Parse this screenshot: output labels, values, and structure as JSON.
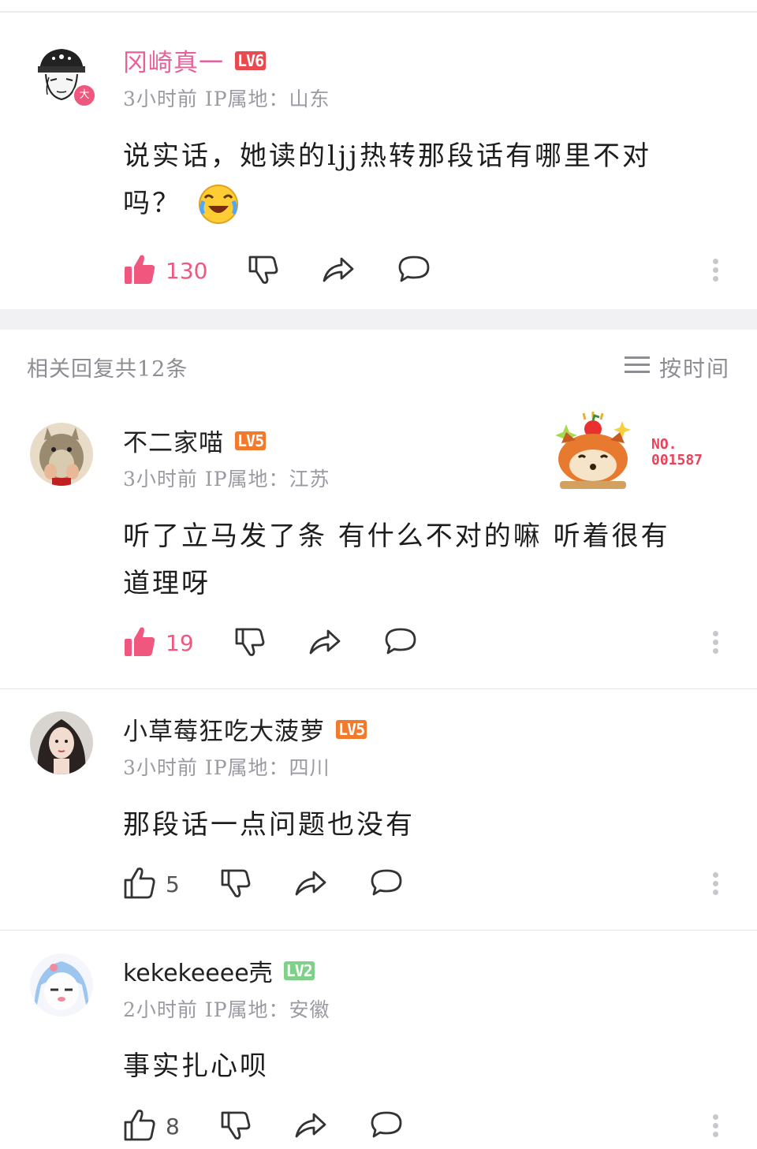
{
  "colors": {
    "accent_pink": "#f0577f",
    "lv6": "#e84a4f",
    "lv5": "#f07a2d",
    "lv2": "#7fd18a",
    "divider": "#f1f1f4"
  },
  "main_comment": {
    "username": "冈崎真一",
    "level": "LV6",
    "avatar_badge": "大",
    "meta": "3小时前 IP属地：山东",
    "text_line1": "说实话，她读的ljj热转那段话有哪里不对",
    "text_line2": "吗？",
    "emoji": "laughing-crying-emoji",
    "likes": "130"
  },
  "replies_header": {
    "label": "相关回复共12条",
    "sort_label": "按时间"
  },
  "replies": [
    {
      "username": "不二家喵",
      "level": "LV5",
      "meta": "3小时前 IP属地：江苏",
      "text_line1": "听了立马发了条 有什么不对的嘛 听着很有",
      "text_line2": "道理呀",
      "likes": "19",
      "sticker_no_1": "NO.",
      "sticker_no_2": "001587"
    },
    {
      "username": "小草莓狂吃大菠萝",
      "level": "LV5",
      "meta": "3小时前 IP属地：四川",
      "text_line1": "那段话一点问题也没有",
      "likes": "5"
    },
    {
      "username": "kekekeeee壳",
      "level": "LV2",
      "meta": "2小时前 IP属地：安徽",
      "text_line1": "事实扎心呗",
      "likes": "8"
    }
  ]
}
